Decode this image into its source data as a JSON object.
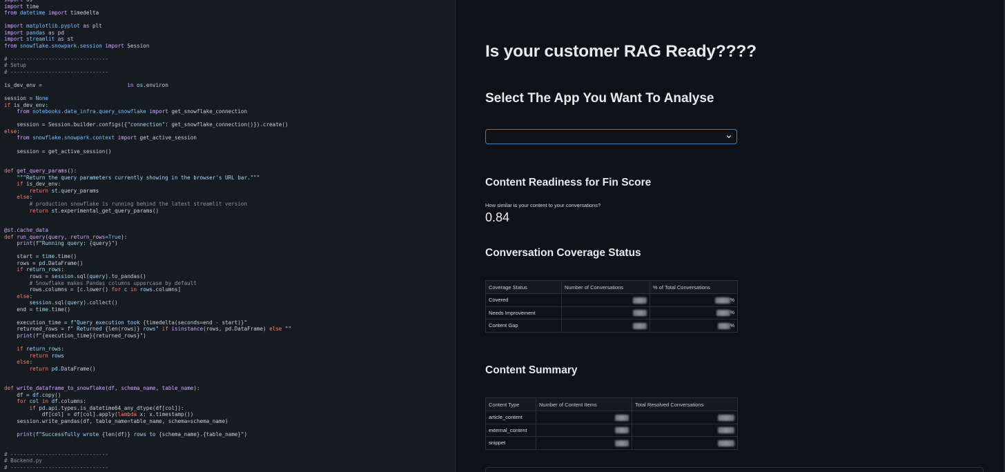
{
  "code": {
    "lines": [
      [
        [
          "kw2",
          "import"
        ],
        [
          "txt",
          " os"
        ]
      ],
      [
        [
          "kw2",
          "import"
        ],
        [
          "txt",
          " time"
        ]
      ],
      [
        [
          "kw2",
          "from"
        ],
        [
          "mod",
          " datetime "
        ],
        [
          "kw2",
          "import"
        ],
        [
          "txt",
          " timedelta"
        ]
      ],
      [],
      [
        [
          "kw2",
          "import"
        ],
        [
          "mod",
          " matplotlib.pyplot "
        ],
        [
          "kw2",
          "as"
        ],
        [
          "txt",
          " plt"
        ]
      ],
      [
        [
          "kw2",
          "import"
        ],
        [
          "mod",
          " pandas "
        ],
        [
          "kw2",
          "as"
        ],
        [
          "txt",
          " pd"
        ]
      ],
      [
        [
          "kw2",
          "import"
        ],
        [
          "mod",
          " streamlit "
        ],
        [
          "kw2",
          "as"
        ],
        [
          "txt",
          " st"
        ]
      ],
      [
        [
          "kw2",
          "from"
        ],
        [
          "mod",
          " snowflake.snowpark.session "
        ],
        [
          "kw2",
          "import"
        ],
        [
          "txt",
          " Session"
        ]
      ],
      [],
      [
        [
          "cm",
          "# -------------------------------"
        ]
      ],
      [
        [
          "cm",
          "# Setup"
        ]
      ],
      [
        [
          "cm",
          "# -------------------------------"
        ]
      ],
      [],
      [
        [
          "txt",
          "is_dev_env = "
        ],
        [
          "blank",
          "                          "
        ],
        [
          "kw2",
          "in"
        ],
        [
          "bl",
          " os"
        ],
        [
          "txt",
          ".environ"
        ]
      ],
      [],
      [
        [
          "txt",
          "session = "
        ],
        [
          "num",
          "None"
        ]
      ],
      [
        [
          "kw",
          "if"
        ],
        [
          "txt",
          " is_dev_env:"
        ]
      ],
      [
        [
          "txt",
          "    "
        ],
        [
          "kw2",
          "from"
        ],
        [
          "mod",
          " notebooks.data_infra.query_snowflake "
        ],
        [
          "kw2",
          "import"
        ],
        [
          "txt",
          " get_snowflake_connection"
        ]
      ],
      [],
      [
        [
          "txt",
          "    session = Session.builder.configs({"
        ],
        [
          "str",
          "\"connection\""
        ],
        [
          "txt",
          ": get_snowflake_connection()}).create()"
        ]
      ],
      [
        [
          "kw",
          "else"
        ],
        [
          "txt",
          ":"
        ]
      ],
      [
        [
          "txt",
          "    "
        ],
        [
          "kw2",
          "from"
        ],
        [
          "mod",
          " snowflake.snowpark.context "
        ],
        [
          "kw2",
          "import"
        ],
        [
          "txt",
          " get_active_session"
        ]
      ],
      [],
      [
        [
          "txt",
          "    session = get_active_session()"
        ]
      ],
      [],
      [],
      [
        [
          "kw",
          "def"
        ],
        [
          "fn",
          " get_query_params"
        ],
        [
          "txt",
          "():"
        ]
      ],
      [
        [
          "str",
          "    \"\"\"Return the query parameters currently showing in the browser's URL bar.\"\"\""
        ]
      ],
      [
        [
          "txt",
          "    "
        ],
        [
          "kw",
          "if"
        ],
        [
          "txt",
          " is_dev_env:"
        ]
      ],
      [
        [
          "txt",
          "        "
        ],
        [
          "kw",
          "return"
        ],
        [
          "bl",
          " st"
        ],
        [
          "txt",
          ".query_params"
        ]
      ],
      [
        [
          "txt",
          "    "
        ],
        [
          "kw",
          "else"
        ],
        [
          "txt",
          ":"
        ]
      ],
      [
        [
          "cm",
          "        # production snowflake is running behind the latest streamlit version"
        ]
      ],
      [
        [
          "txt",
          "        "
        ],
        [
          "kw",
          "return"
        ],
        [
          "bl",
          " st"
        ],
        [
          "txt",
          ".experimental_get_query_params()"
        ]
      ],
      [],
      [],
      [
        [
          "dec",
          "@st.cache_data"
        ]
      ],
      [
        [
          "kw",
          "def"
        ],
        [
          "fn",
          " run_query"
        ],
        [
          "txt",
          "("
        ],
        [
          "fn",
          "query"
        ],
        [
          "txt",
          ", "
        ],
        [
          "fn",
          "return_rows"
        ],
        [
          "txt",
          "="
        ],
        [
          "num",
          "True"
        ],
        [
          "txt",
          "):"
        ]
      ],
      [
        [
          "txt",
          "    "
        ],
        [
          "fn",
          "print"
        ],
        [
          "txt",
          "("
        ],
        [
          "str",
          "f\"Running query: "
        ],
        [
          "txt",
          "{query}"
        ],
        [
          "str",
          "\""
        ],
        [
          "txt",
          ")"
        ]
      ],
      [],
      [
        [
          "txt",
          "    start = "
        ],
        [
          "bl",
          "time"
        ],
        [
          "txt",
          ".time()"
        ]
      ],
      [
        [
          "txt",
          "    rows = "
        ],
        [
          "bl",
          "pd"
        ],
        [
          "txt",
          ".DataFrame()"
        ]
      ],
      [
        [
          "txt",
          "    "
        ],
        [
          "kw",
          "if"
        ],
        [
          "bl",
          " return_rows"
        ],
        [
          "txt",
          ":"
        ]
      ],
      [
        [
          "txt",
          "        rows = "
        ],
        [
          "bl",
          "session"
        ],
        [
          "txt",
          ".sql("
        ],
        [
          "bl",
          "query"
        ],
        [
          "txt",
          ").to_pandas()"
        ]
      ],
      [
        [
          "cm",
          "        # Snowflake makes Pandas columns uppercase by default"
        ]
      ],
      [
        [
          "txt",
          "        rows.columns = ["
        ],
        [
          "bl",
          "c"
        ],
        [
          "txt",
          ".lower() "
        ],
        [
          "kw",
          "for"
        ],
        [
          "bl",
          " c "
        ],
        [
          "kw",
          "in"
        ],
        [
          "bl",
          " rows"
        ],
        [
          "txt",
          ".columns]"
        ]
      ],
      [
        [
          "txt",
          "    "
        ],
        [
          "kw",
          "else"
        ],
        [
          "txt",
          ":"
        ]
      ],
      [
        [
          "txt",
          "        "
        ],
        [
          "bl",
          "session"
        ],
        [
          "txt",
          ".sql("
        ],
        [
          "bl",
          "query"
        ],
        [
          "txt",
          ").collect()"
        ]
      ],
      [
        [
          "txt",
          "    end = "
        ],
        [
          "bl",
          "time"
        ],
        [
          "txt",
          ".time()"
        ]
      ],
      [],
      [
        [
          "txt",
          "    execution_time = "
        ],
        [
          "str",
          "f\"Query execution took "
        ],
        [
          "txt",
          "{timedelta(seconds=end - start)}"
        ],
        [
          "str",
          "\""
        ]
      ],
      [
        [
          "txt",
          "    returned_rows = "
        ],
        [
          "str",
          "f\" Returned "
        ],
        [
          "txt",
          "{len(rows)}"
        ],
        [
          "str",
          " rows\" "
        ],
        [
          "kw",
          "if"
        ],
        [
          "fn",
          " isinstance"
        ],
        [
          "txt",
          "(rows, pd.DataFrame) "
        ],
        [
          "kw",
          "else"
        ],
        [
          "str",
          " \"\""
        ]
      ],
      [
        [
          "txt",
          "    "
        ],
        [
          "fn",
          "print"
        ],
        [
          "txt",
          "("
        ],
        [
          "str",
          "f\""
        ],
        [
          "txt",
          "{execution_time}{returned_rows}"
        ],
        [
          "str",
          "\""
        ],
        [
          "txt",
          ")"
        ]
      ],
      [],
      [
        [
          "txt",
          "    "
        ],
        [
          "kw",
          "if"
        ],
        [
          "bl",
          " return_rows"
        ],
        [
          "txt",
          ":"
        ]
      ],
      [
        [
          "txt",
          "        "
        ],
        [
          "kw",
          "return"
        ],
        [
          "bl",
          " rows"
        ]
      ],
      [
        [
          "txt",
          "    "
        ],
        [
          "kw",
          "else"
        ],
        [
          "txt",
          ":"
        ]
      ],
      [
        [
          "txt",
          "        "
        ],
        [
          "kw",
          "return"
        ],
        [
          "bl",
          " pd"
        ],
        [
          "txt",
          ".DataFrame()"
        ]
      ],
      [],
      [],
      [
        [
          "kw",
          "def"
        ],
        [
          "fn",
          " write_dataframe_to_snowflake"
        ],
        [
          "txt",
          "("
        ],
        [
          "fn",
          "df"
        ],
        [
          "txt",
          ", "
        ],
        [
          "fn",
          "schema_name"
        ],
        [
          "txt",
          ", "
        ],
        [
          "fn",
          "table_name"
        ],
        [
          "txt",
          "):"
        ]
      ],
      [
        [
          "txt",
          "    df = "
        ],
        [
          "bl",
          "df"
        ],
        [
          "txt",
          ".copy()"
        ]
      ],
      [
        [
          "txt",
          "    "
        ],
        [
          "kw",
          "for"
        ],
        [
          "bl",
          " col "
        ],
        [
          "kw",
          "in"
        ],
        [
          "bl",
          " df"
        ],
        [
          "txt",
          ".columns:"
        ]
      ],
      [
        [
          "txt",
          "        "
        ],
        [
          "kw",
          "if"
        ],
        [
          "bl",
          " pd"
        ],
        [
          "txt",
          ".api.types.is_datetime64_any_dtype(df[col]):"
        ]
      ],
      [
        [
          "txt",
          "            df[col] = df[col].apply("
        ],
        [
          "kw",
          "lambda"
        ],
        [
          "txt",
          " x: x.timestamp())"
        ]
      ],
      [
        [
          "txt",
          "    session.write_pandas(df, table_name=table_name, schema=schema_name)"
        ]
      ],
      [],
      [
        [
          "txt",
          "    "
        ],
        [
          "fn",
          "print"
        ],
        [
          "txt",
          "("
        ],
        [
          "str",
          "f\"Successfully wrote "
        ],
        [
          "txt",
          "{len(df)}"
        ],
        [
          "str",
          " rows to "
        ],
        [
          "txt",
          "{schema_name}"
        ],
        [
          "str",
          "."
        ],
        [
          "txt",
          "{table_name}"
        ],
        [
          "str",
          "\""
        ],
        [
          "txt",
          ")"
        ]
      ],
      [],
      [],
      [
        [
          "cm",
          "# -------------------------------"
        ]
      ],
      [
        [
          "cm",
          "# Backend.py"
        ]
      ],
      [
        [
          "cm",
          "# -------------------------------"
        ]
      ]
    ]
  },
  "app": {
    "title": "Is your customer RAG Ready????",
    "select_heading": "Select The App You Want To Analyse",
    "select_value": "",
    "readiness": {
      "heading": "Content Readiness for Fin Score",
      "metric_label": "How similar is your content to your conversations?",
      "metric_value": "0.84"
    },
    "coverage": {
      "heading": "Conversation Coverage Status",
      "columns": [
        "Coverage Status",
        "Number of Conversations",
        "% of Total Conversations"
      ],
      "rows": [
        {
          "status": "Covered",
          "pct_suffix": "%"
        },
        {
          "status": "Needs Improvement",
          "pct_suffix": "%"
        },
        {
          "status": "Content Gap",
          "pct_suffix": "%"
        }
      ]
    },
    "summary": {
      "heading": "Content Summary",
      "columns": [
        "Content Type",
        "Number of Content Items",
        "Total Resolved Conversations"
      ],
      "rows": [
        {
          "type": "article_content"
        },
        {
          "type": "external_content"
        },
        {
          "type": "snippet"
        }
      ]
    }
  },
  "colors": {
    "editor_bg": "#161b22",
    "app_bg": "#0f1117",
    "select_border": "#3b82c4",
    "keyword": "#ff7b72",
    "string": "#a5d6ff",
    "comment": "#8b949e"
  }
}
